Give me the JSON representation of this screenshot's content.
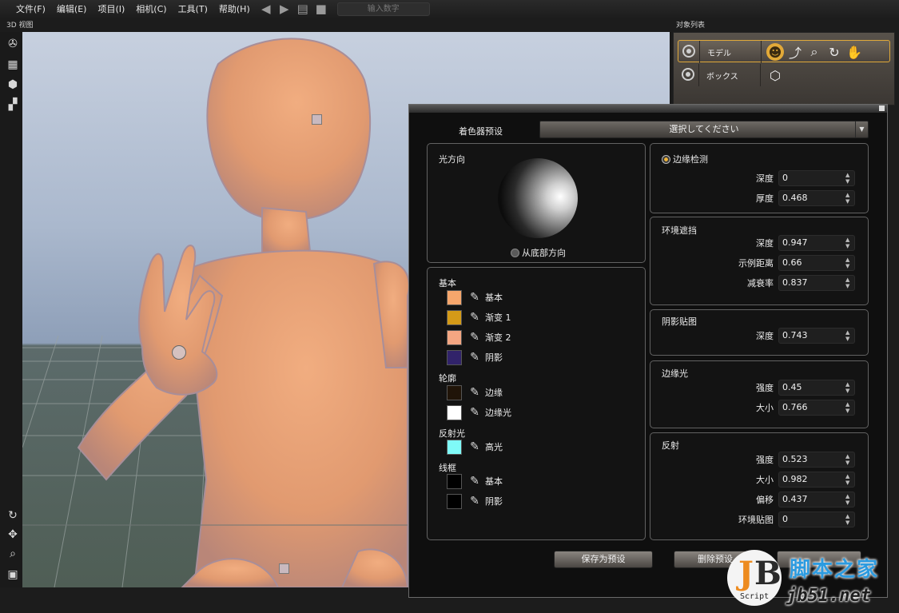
{
  "menubar": {
    "items": [
      "文件(F)",
      "编辑(E)",
      "项目(I)",
      "相机(C)",
      "工具(T)",
      "帮助(H)"
    ],
    "number_input_placeholder": "输入数字"
  },
  "viewport": {
    "label": "3D 视图"
  },
  "object_list": {
    "label": "对象列表",
    "rows": [
      {
        "name": "モデル",
        "selected": true,
        "tools": [
          "figure-icon",
          "pose-icon",
          "zoom-icon",
          "rotate-icon",
          "hand-icon"
        ]
      },
      {
        "name": "ボックス",
        "selected": false,
        "tools": [
          "box-icon"
        ]
      }
    ]
  },
  "shader_dialog": {
    "preset_label": "着色器预设",
    "preset_value": "選択してください",
    "light_direction": {
      "title": "光方向",
      "from_bottom_label": "从底部方向"
    },
    "colors": {
      "basic_title": "基本",
      "basic": [
        {
          "label": "基本",
          "color": "#F6A66C"
        },
        {
          "label": "渐变 1",
          "color": "#D49A18"
        },
        {
          "label": "渐变 2",
          "color": "#F4A682"
        },
        {
          "label": "阴影",
          "color": "#31236A"
        }
      ],
      "outline_title": "轮廓",
      "outline": [
        {
          "label": "边缘",
          "color": "#201408"
        },
        {
          "label": "边缘光",
          "color": "#FFFFFF"
        }
      ],
      "reflect_title": "反射光",
      "reflect": [
        {
          "label": "高光",
          "color": "#7FFAF8"
        }
      ],
      "wire_title": "线框",
      "wire": [
        {
          "label": "基本",
          "color": "#000000"
        },
        {
          "label": "阴影",
          "color": "#000000"
        }
      ]
    },
    "edge_detect": {
      "radio_label": "边缘检测",
      "depth_label": "深度",
      "depth": "0",
      "thickness_label": "厚度",
      "thickness": "0.468"
    },
    "ambient_occlusion": {
      "title": "环境遮挡",
      "depth_label": "深度",
      "depth": "0.947",
      "sample_label": "示例距离",
      "sample": "0.66",
      "decay_label": "减衰率",
      "decay": "0.837"
    },
    "shadow_map": {
      "title": "阴影贴图",
      "depth_label": "深度",
      "depth": "0.743"
    },
    "rim_light": {
      "title": "边缘光",
      "strength_label": "强度",
      "strength": "0.45",
      "size_label": "大小",
      "size": "0.766"
    },
    "reflection": {
      "title": "反射",
      "strength_label": "强度",
      "strength": "0.523",
      "size_label": "大小",
      "size": "0.982",
      "offset_label": "偏移",
      "offset": "0.437",
      "env_label": "环境贴图",
      "env": "0"
    },
    "buttons": {
      "save": "保存为预设",
      "delete": "删除预设"
    }
  },
  "watermark": {
    "logo_j": "J",
    "logo_b": "B",
    "logo_script": "Script",
    "site_name": "脚本之家",
    "url": "jb51.net"
  },
  "colors": {
    "accent": "#E2A938",
    "panel_bg": "#0F0F0F",
    "skin": "#E9A37A"
  }
}
